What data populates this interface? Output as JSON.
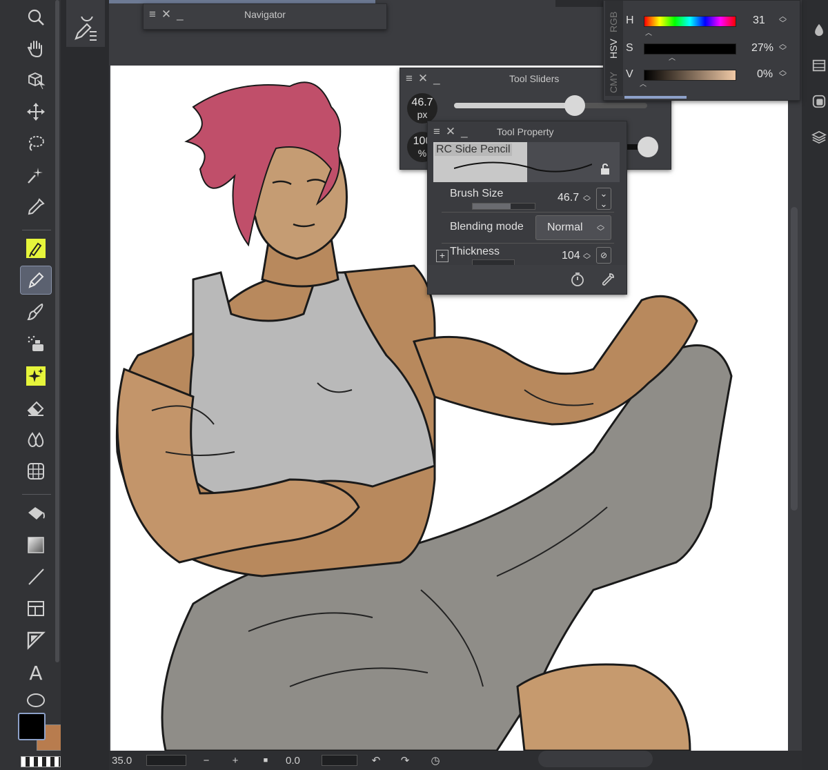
{
  "navigator": {
    "title": "Navigator"
  },
  "tool_sliders": {
    "title": "Tool Sliders",
    "size_value": "46.7",
    "size_unit": "px",
    "opacity_value": "100",
    "opacity_unit": "%"
  },
  "tool_property": {
    "title": "Tool Property",
    "brush_name": "RC Side Pencil",
    "rows": [
      {
        "label": "Brush Size",
        "value": "46.7"
      },
      {
        "label": "Blending mode",
        "value": "Normal"
      },
      {
        "label": "Thickness",
        "value": "104"
      }
    ]
  },
  "color_panel": {
    "tabs": [
      "RGB",
      "HSV",
      "CMY"
    ],
    "active_tab": "HSV",
    "sliders": [
      {
        "label": "H",
        "value": "31",
        "level": 0.086
      },
      {
        "label": "S",
        "value": "27%",
        "level": 0.27
      },
      {
        "label": "V",
        "value": "0%",
        "level": 0.0
      }
    ]
  },
  "bottom_bar": {
    "zoom": "35.0",
    "rotation": "0.0"
  },
  "colors": {
    "main_color": "#000000",
    "sub_color": "#b87c4e",
    "accent_active": "#5b6170",
    "highlight_yellow": "#e6f53b"
  },
  "icons": [
    "zoom-icon",
    "hand-icon",
    "object-icon",
    "move-icon",
    "lasso-icon",
    "magic-wand-icon",
    "eyedropper-icon",
    "marker-icon",
    "pen-icon",
    "brush-icon",
    "airbrush-icon",
    "decoration-icon",
    "eraser-icon",
    "blend-icon",
    "figure-icon",
    "fill-icon",
    "gradient-icon",
    "line-icon",
    "frame-icon",
    "ruler-icon",
    "text-icon",
    "shape-icon"
  ]
}
